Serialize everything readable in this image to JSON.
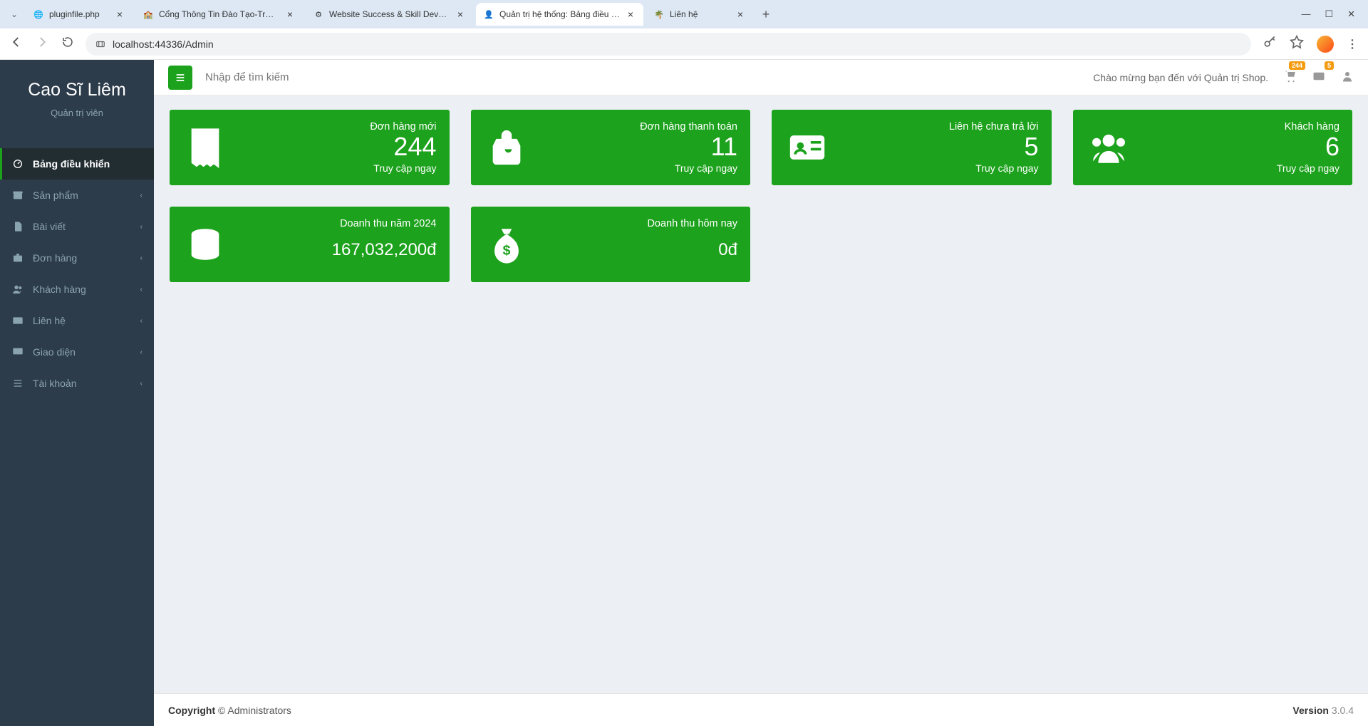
{
  "browser": {
    "tabs": [
      {
        "title": "pluginfile.php"
      },
      {
        "title": "Cổng Thông Tin Đào Tạo-Trườ..."
      },
      {
        "title": "Website Success & Skill Develo..."
      },
      {
        "title": "Quản trị hệ thống: Bảng điều k..."
      },
      {
        "title": "Liên hệ"
      }
    ],
    "url": "localhost:44336/Admin"
  },
  "sidebar": {
    "user_name": "Cao Sĩ Liêm",
    "role": "Quản trị viên",
    "items": [
      {
        "label": "Bảng điều khiển"
      },
      {
        "label": "Sản phẩm"
      },
      {
        "label": "Bài viết"
      },
      {
        "label": "Đơn hàng"
      },
      {
        "label": "Khách hàng"
      },
      {
        "label": "Liên hệ"
      },
      {
        "label": "Giao diện"
      },
      {
        "label": "Tài khoản"
      }
    ]
  },
  "topbar": {
    "search_placeholder": "Nhập để tìm kiếm",
    "welcome": "Chào mừng bạn đến với Quản trị Shop.",
    "badge_cart": "244",
    "badge_contact": "5"
  },
  "cards": [
    {
      "title": "Đơn hàng mới",
      "value": "244",
      "link": "Truy cập ngay"
    },
    {
      "title": "Đơn hàng thanh toán",
      "value": "11",
      "link": "Truy cập ngay"
    },
    {
      "title": "Liên hệ chưa trả lời",
      "value": "5",
      "link": "Truy cập ngay"
    },
    {
      "title": "Khách hàng",
      "value": "6",
      "link": "Truy cập ngay"
    },
    {
      "title": "Doanh thu năm 2024",
      "value": "167,032,200đ"
    },
    {
      "title": "Doanh thu hôm nay",
      "value": "0đ"
    }
  ],
  "footer": {
    "copyright_label": "Copyright",
    "owner": " © Administrators",
    "version_label": "Version",
    "version": " 3.0.4"
  }
}
